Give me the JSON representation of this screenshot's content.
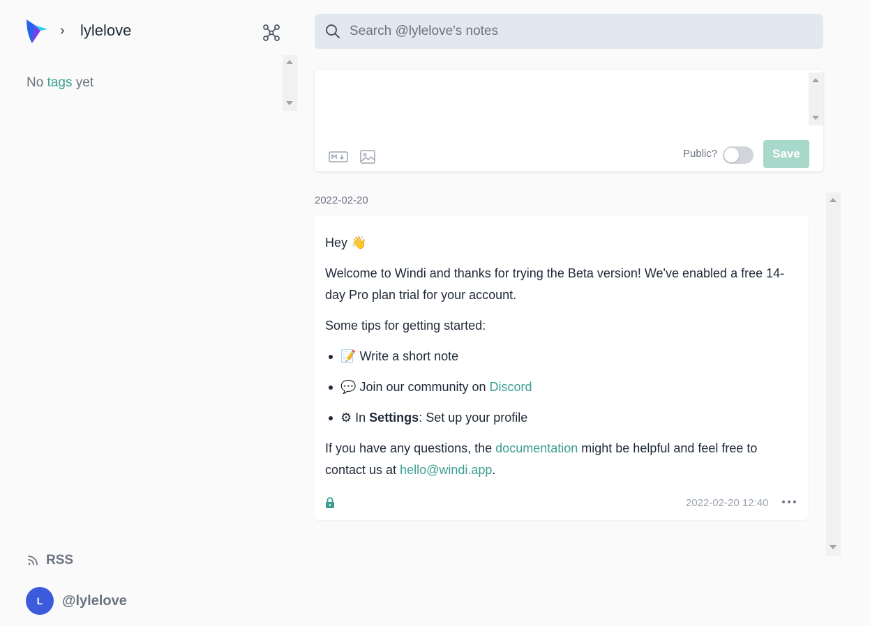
{
  "sidebar": {
    "breadcrumb_chevron": "›",
    "username_title": "lylelove",
    "tags": {
      "prefix": "No ",
      "link": "tags",
      "suffix": " yet"
    },
    "rss_label": "RSS",
    "account": {
      "avatar_initial": "L",
      "handle": "@lylelove"
    }
  },
  "search": {
    "placeholder": "Search @lylelove's notes"
  },
  "composer": {
    "public_label": "Public?",
    "public_enabled": false,
    "save_label": "Save"
  },
  "feed": {
    "date_heading": "2022-02-20",
    "note": {
      "greeting": "Hey",
      "greeting_emoji": "👋",
      "welcome": "Welcome to Windi and thanks for trying the Beta version! We've enabled a free 14-day Pro plan trial for your account.",
      "tips_heading": "Some tips for getting started:",
      "tip1_emoji": "📝",
      "tip1_text": "Write a short note",
      "tip2_emoji": "💬",
      "tip2_text": "Join our community on ",
      "tip2_link": "Discord",
      "tip3_emoji": "⚙",
      "tip3_prefix": "In ",
      "tip3_bold": "Settings",
      "tip3_suffix": ": Set up your profile",
      "questions_prefix": "If you have any questions, the ",
      "questions_link": "documentation",
      "questions_middle": " might be helpful and feel free to contact us at ",
      "questions_email": "hello@windi.app",
      "questions_end": ".",
      "timestamp": "2022-02-20 12:40"
    }
  },
  "colors": {
    "accent": "#3b9e8f",
    "avatar": "#3b5bdb",
    "save_disabled": "#a7d8c9",
    "search_bg": "#e2e8f0"
  },
  "icons": {
    "logo": "windi-logo-icon",
    "graph": "graph-view-icon",
    "search": "search-icon",
    "markdown": "markdown-icon",
    "image": "image-icon",
    "lock": "lock-icon",
    "more": "more-horizontal-icon",
    "rss": "rss-icon"
  }
}
